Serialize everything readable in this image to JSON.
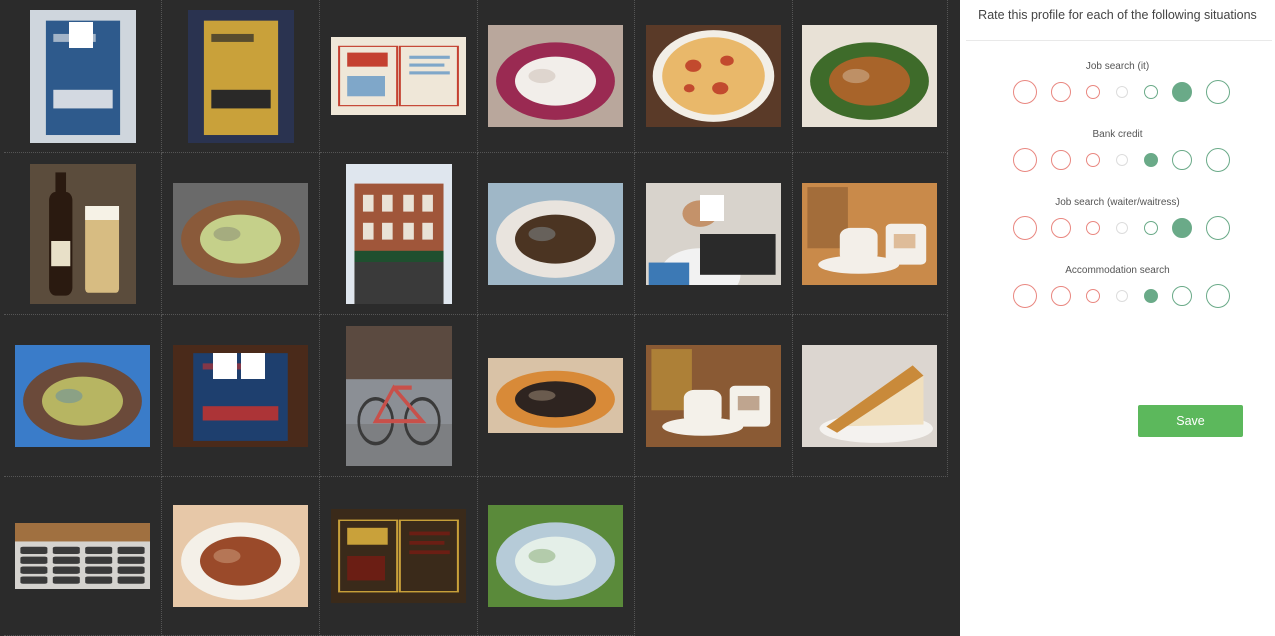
{
  "panel": {
    "title": "Rate this profile for each of the following situations",
    "save_label": "Save"
  },
  "colors": {
    "negative_ring": "#e98780",
    "neutral_ring": "#dddddd",
    "positive_ring": "#6aaa88",
    "selected_fill": "#6aaa88",
    "save_button": "#5cb85c",
    "gallery_bg": "#2b2b2b"
  },
  "questions": [
    {
      "label": "Job search (it)",
      "selected": 6
    },
    {
      "label": "Bank credit",
      "selected": 5
    },
    {
      "label": "Job search (waiter/waitress)",
      "selected": 6
    },
    {
      "label": "Accommodation search",
      "selected": 5
    }
  ],
  "scale_points": 7,
  "photos": [
    {
      "name": "photo-book-cover-hero",
      "icon": "book-cover",
      "colors": [
        "#cfd6dd",
        "#2e5a8c",
        "#f0f0f0"
      ],
      "face_boxes": 1
    },
    {
      "name": "photo-book-cover-space",
      "icon": "book-cover",
      "colors": [
        "#2a3350",
        "#c9a13a",
        "#0e1426"
      ],
      "face_boxes": 0
    },
    {
      "name": "photo-open-book-illustration",
      "icon": "book-open",
      "colors": [
        "#efe7d8",
        "#c44030",
        "#7fa7c9"
      ],
      "face_boxes": 0
    },
    {
      "name": "photo-plate-crepe",
      "icon": "food-plate",
      "colors": [
        "#b9a79c",
        "#f2eeea",
        "#9a2a52"
      ],
      "face_boxes": 0
    },
    {
      "name": "photo-pizza",
      "icon": "pizza",
      "colors": [
        "#5a3a28",
        "#e9b86a",
        "#c24a2e"
      ],
      "face_boxes": 0
    },
    {
      "name": "photo-spaghetti",
      "icon": "food-plate",
      "colors": [
        "#e8e1d6",
        "#a8642a",
        "#3e6b2a"
      ],
      "face_boxes": 0
    },
    {
      "name": "photo-beer-bottle-glass",
      "icon": "beer",
      "colors": [
        "#5b4c3c",
        "#2a1a10",
        "#e4c98a"
      ],
      "face_boxes": 0
    },
    {
      "name": "photo-cabbage-salad",
      "icon": "food-plate",
      "colors": [
        "#6a6a6a",
        "#c5d08a",
        "#8a5a3a"
      ],
      "face_boxes": 0
    },
    {
      "name": "photo-brick-building",
      "icon": "building",
      "colors": [
        "#dfe6ee",
        "#a0563a",
        "#1f4f2f"
      ],
      "face_boxes": 0
    },
    {
      "name": "photo-stir-fry-plate",
      "icon": "food-plate",
      "colors": [
        "#9fb7c7",
        "#4b3422",
        "#e9e4de"
      ],
      "face_boxes": 0
    },
    {
      "name": "photo-person-laptop",
      "icon": "person",
      "colors": [
        "#d8d3cc",
        "#2a2a2a",
        "#3c79b5"
      ],
      "face_boxes": 1
    },
    {
      "name": "photo-tea-set",
      "icon": "tea",
      "colors": [
        "#c98a4a",
        "#f3efe9",
        "#8a5a30"
      ],
      "face_boxes": 0
    },
    {
      "name": "photo-noodle-soup-bowl",
      "icon": "food-plate",
      "colors": [
        "#3a7cc9",
        "#b7b562",
        "#6b4a3a"
      ],
      "face_boxes": 0
    },
    {
      "name": "photo-book-on-table",
      "icon": "book-cover",
      "colors": [
        "#4a2a1a",
        "#1e3f6e",
        "#c6322e"
      ],
      "face_boxes": 2
    },
    {
      "name": "photo-bicycle-street",
      "icon": "bicycle",
      "colors": [
        "#8b8f95",
        "#c8504a",
        "#3a3a3a"
      ],
      "face_boxes": 0
    },
    {
      "name": "photo-fish-and-chips",
      "icon": "food-plate",
      "colors": [
        "#d9c2a6",
        "#2e2420",
        "#d88a38"
      ],
      "face_boxes": 0
    },
    {
      "name": "photo-soup-cup-dessert",
      "icon": "tea",
      "colors": [
        "#8a5a34",
        "#f4f1ea",
        "#c49a3a"
      ],
      "face_boxes": 0
    },
    {
      "name": "photo-cake-slice",
      "icon": "cake",
      "colors": [
        "#dcd6d0",
        "#c98a3a",
        "#f0dfbe"
      ],
      "face_boxes": 0
    },
    {
      "name": "photo-laptop-keyboard",
      "icon": "keyboard",
      "colors": [
        "#c9c3b8",
        "#3a3a3a",
        "#a07040"
      ],
      "face_boxes": 0
    },
    {
      "name": "photo-larb-salad",
      "icon": "food-plate",
      "colors": [
        "#e7c8a8",
        "#9a4a2a",
        "#f4f0e8"
      ],
      "face_boxes": 0
    },
    {
      "name": "photo-book-cover-back",
      "icon": "book-open",
      "colors": [
        "#3a2a1a",
        "#c9a13a",
        "#6b1e14"
      ],
      "face_boxes": 0
    },
    {
      "name": "photo-green-salad",
      "icon": "food-plate",
      "colors": [
        "#5a8a3a",
        "#e4efe8",
        "#b6cbd8"
      ],
      "face_boxes": 0
    }
  ]
}
